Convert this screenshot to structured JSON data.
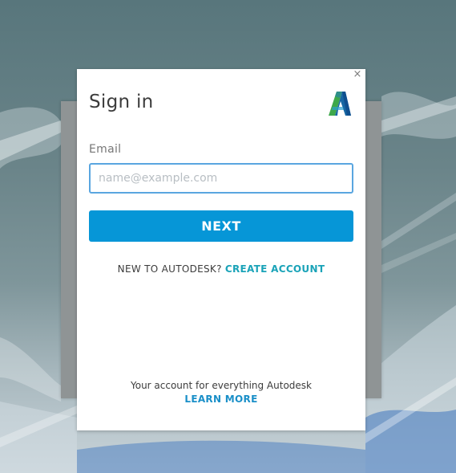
{
  "dialog": {
    "title": "Sign in",
    "close_glyph": "×",
    "logo_icon": "autodesk-logo-icon"
  },
  "email": {
    "label": "Email",
    "value": "",
    "placeholder": "name@example.com"
  },
  "next_button": {
    "label": "NEXT"
  },
  "signup": {
    "prompt": "NEW TO AUTODESK?",
    "link": "CREATE ACCOUNT"
  },
  "footer": {
    "tagline": "Your account for everything Autodesk",
    "learn_more": "LEARN MORE"
  },
  "colors": {
    "primary_button": "#0696d7",
    "create_link": "#1aa3b8",
    "learn_more": "#1a8fc8",
    "input_border": "#5aa6e0"
  }
}
